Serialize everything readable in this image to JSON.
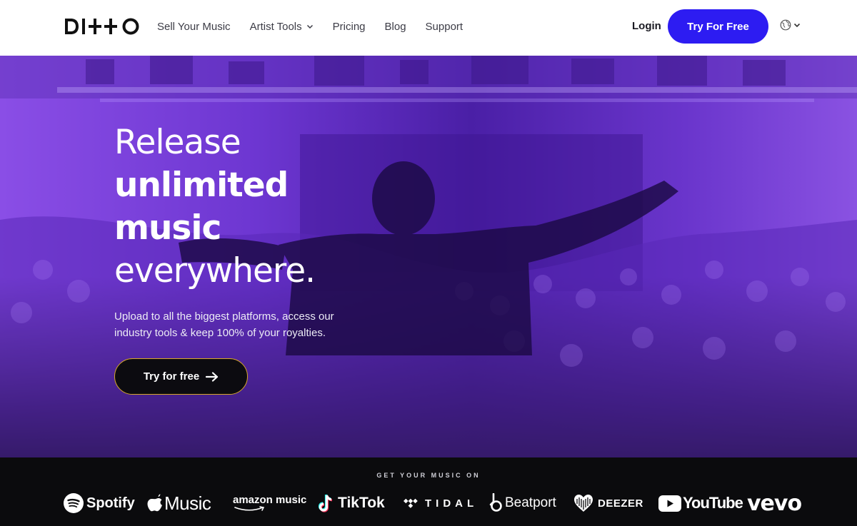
{
  "header": {
    "logo_text": "DI++O",
    "nav": [
      {
        "label": "Sell Your Music",
        "has_dropdown": false
      },
      {
        "label": "Artist Tools",
        "has_dropdown": true
      },
      {
        "label": "Pricing",
        "has_dropdown": false
      },
      {
        "label": "Blog",
        "has_dropdown": false
      },
      {
        "label": "Support",
        "has_dropdown": false
      }
    ],
    "login_label": "Login",
    "cta_label": "Try For Free",
    "language_icon": "globe-icon"
  },
  "hero": {
    "headline": [
      "Release",
      "unlimited",
      "music",
      "everywhere."
    ],
    "subtext": "Upload to all the biggest platforms, access our industry tools & keep 100% of your royalties.",
    "cta_label": "Try for free"
  },
  "platforms": {
    "title": "GET YOUR MUSIC ON",
    "items": [
      {
        "name": "Spotify",
        "icon": "spotify-icon"
      },
      {
        "name": "Music",
        "icon": "apple-icon"
      },
      {
        "name": "amazon music",
        "icon": "amazon-smile-icon"
      },
      {
        "name": "TikTok",
        "icon": "tiktok-icon"
      },
      {
        "name": "TIDAL",
        "icon": "tidal-icon"
      },
      {
        "name": "Beatport",
        "icon": "beatport-icon"
      },
      {
        "name": "DEEZER",
        "icon": "deezer-heart-icon"
      },
      {
        "name": "YouTube",
        "icon": "youtube-icon"
      },
      {
        "name": "vevo",
        "icon": "vevo-wordmark"
      }
    ]
  },
  "colors": {
    "brand_blue": "#2d1cf2",
    "hero_purple": "#7a3fe0",
    "cta_outline": "#d6a62a",
    "dark": "#0b0b0d"
  }
}
